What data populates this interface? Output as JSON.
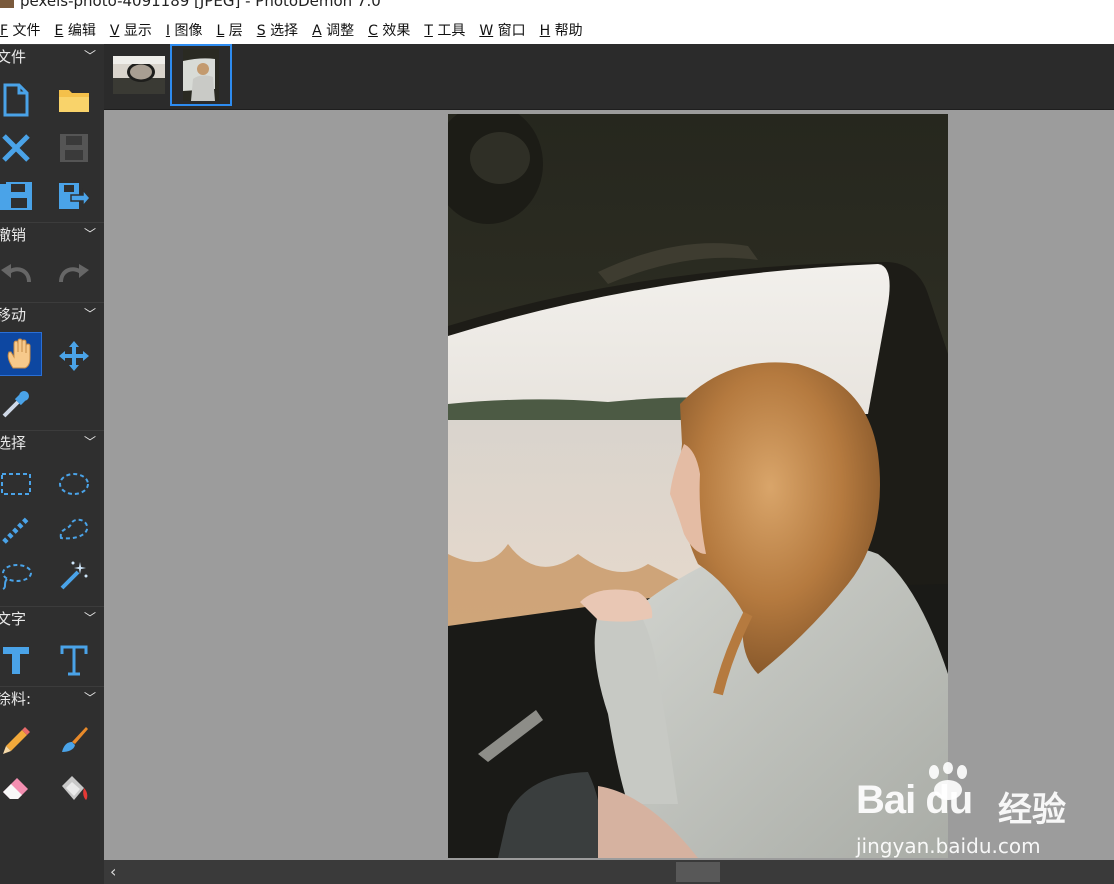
{
  "window": {
    "title": "pexels-photo-4091189 [JPEG] - PhotoDemon 7.0"
  },
  "menu": [
    {
      "key": "F",
      "label": "文件"
    },
    {
      "key": "E",
      "label": "编辑"
    },
    {
      "key": "V",
      "label": "显示"
    },
    {
      "key": "I",
      "label": "图像"
    },
    {
      "key": "L",
      "label": "层"
    },
    {
      "key": "S",
      "label": "选择"
    },
    {
      "key": "A",
      "label": "调整"
    },
    {
      "key": "C",
      "label": "效果"
    },
    {
      "key": "T",
      "label": "工具"
    },
    {
      "key": "W",
      "label": "窗口"
    },
    {
      "key": "H",
      "label": "帮助"
    }
  ],
  "toolbox": {
    "sections": [
      {
        "label": "文件",
        "chevron": "﹀"
      },
      {
        "label": "撤销",
        "chevron": "﹀"
      },
      {
        "label": "移动",
        "chevron": "﹀"
      },
      {
        "label": "选择",
        "chevron": "﹀"
      },
      {
        "label": "文字",
        "chevron": "﹀"
      },
      {
        "label": "涂料:",
        "chevron": "﹀"
      }
    ]
  },
  "thumbnails": [
    {
      "name": "car-mirror-photo",
      "selected": false
    },
    {
      "name": "girl-in-car-photo",
      "selected": true
    }
  ],
  "scrollbar": {
    "left_arrow": "‹"
  },
  "watermark": {
    "brand": "Bai du",
    "brand_cn": "经验",
    "url": "jingyan.baidu.com"
  },
  "colors": {
    "toolbox_bg": "#2f2f2f",
    "canvas_bg": "#9c9c9c",
    "accent_blue": "#2e8cf0",
    "icon_blue": "#4aa3e8",
    "active_tool": "#0d47a1"
  }
}
